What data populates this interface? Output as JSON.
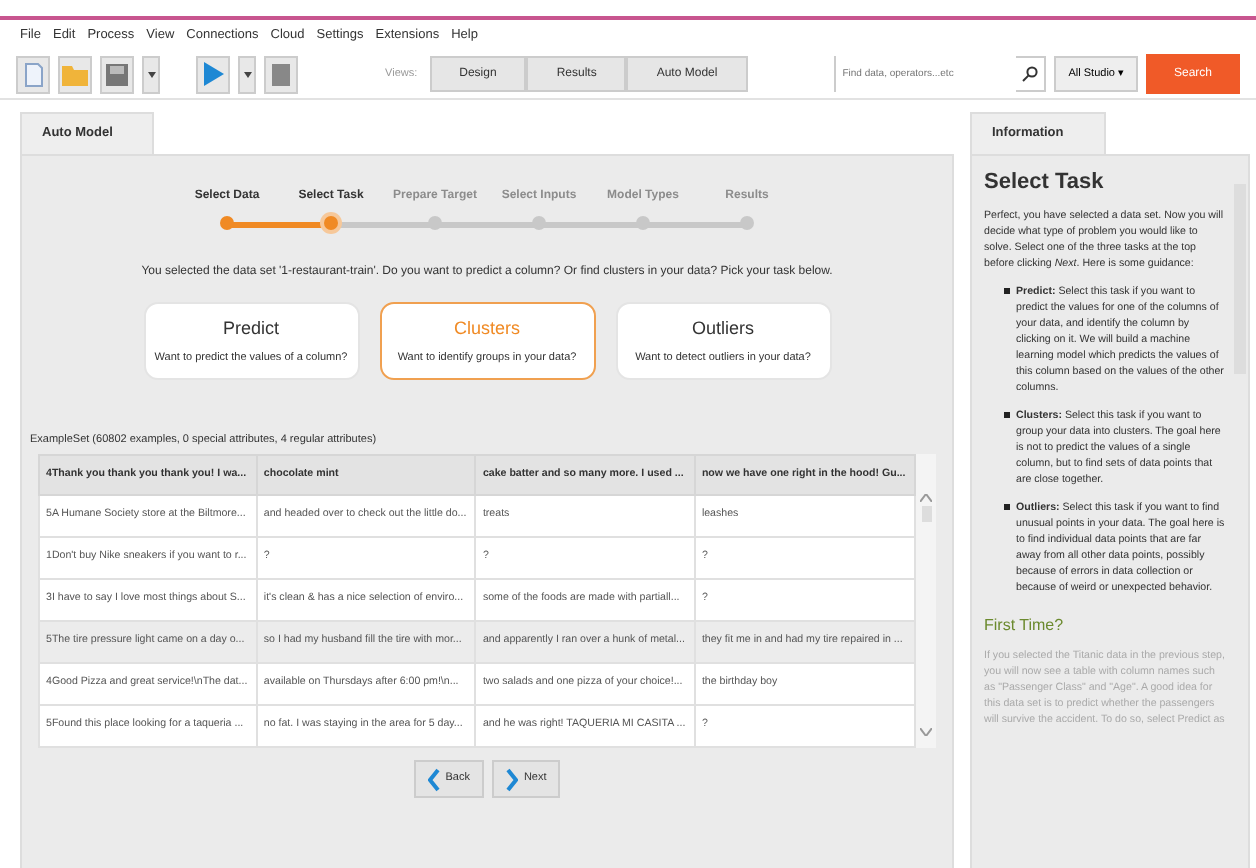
{
  "menu": [
    "File",
    "Edit",
    "Process",
    "View",
    "Connections",
    "Cloud",
    "Settings",
    "Extensions",
    "Help"
  ],
  "views": {
    "label": "Views:",
    "buttons": [
      "Design",
      "Results",
      "Auto Model"
    ]
  },
  "search": {
    "placeholder": "Find data, operators...etc",
    "scope": "All Studio ▾",
    "button": "Search"
  },
  "main_tab": "Auto Model",
  "steps": [
    {
      "label": "Select Data",
      "done": true,
      "selected": false
    },
    {
      "label": "Select Task",
      "done": true,
      "selected": true
    },
    {
      "label": "Prepare Target",
      "done": false,
      "selected": false
    },
    {
      "label": "Select Inputs",
      "done": false,
      "selected": false
    },
    {
      "label": "Model Types",
      "done": false,
      "selected": false
    },
    {
      "label": "Results",
      "done": false,
      "selected": false
    }
  ],
  "prompt": "You selected the data set '1-restaurant-train'. Do you want to predict a column?  Or find clusters in your data?  Pick your task below.",
  "tasks": [
    {
      "title": "Predict",
      "description": "Want to predict the values of a column?",
      "selected": false
    },
    {
      "title": "Clusters",
      "description": "Want to identify groups in your data?",
      "selected": true
    },
    {
      "title": "Outliers",
      "description": "Want to detect outliers in your data?",
      "selected": false
    }
  ],
  "table": {
    "caption": "ExampleSet (60802 examples, 0 special attributes, 4 regular attributes)",
    "columns": [
      "4Thank you thank you thank you! I wa...",
      "chocolate mint",
      "cake batter and so many more.  I used ...",
      "now we have one right in the hood! Gu..."
    ],
    "rows": [
      {
        "cells": [
          "5A Humane Society store at the Biltmore...",
          "and headed over to check out the little do...",
          "treats",
          "leashes"
        ],
        "selected": false
      },
      {
        "cells": [
          "1Don't buy Nike sneakers if you want to r...",
          "?",
          "?",
          "?"
        ],
        "selected": false
      },
      {
        "cells": [
          "3I have to say I love most things about S...",
          "it's clean & has a nice selection of enviro...",
          "some of the foods are made with partiall...",
          "?"
        ],
        "selected": false
      },
      {
        "cells": [
          "5The tire pressure light came on a day o...",
          "so I had my husband fill the tire with mor...",
          "and apparently I ran over a hunk of metal...",
          "they fit me in and had my tire repaired in ..."
        ],
        "selected": true
      },
      {
        "cells": [
          "4Good Pizza and great service!\\nThe dat...",
          "available on Thursdays after 6:00 pm!\\n...",
          "two salads and one pizza of your choice!...",
          "the birthday boy"
        ],
        "selected": false
      },
      {
        "cells": [
          "5Found this place looking for a taqueria ...",
          "no fat. I was staying in the area for 5 day...",
          "and he was right! TAQUERIA MI CASITA ...",
          "?"
        ],
        "selected": false
      }
    ]
  },
  "nav": {
    "back": "Back",
    "next": "Next"
  },
  "info": {
    "tab": "Information",
    "title": "Select Task",
    "intro": "Perfect, you have selected a data set. Now you will decide what type of problem you would like to solve. Select one of the three tasks at the top before clicking *Next*. Here is some guidance:",
    "bullets": [
      "**Predict:** Select this task if you want to predict the values for one of the columns of your data, and identify the column by clicking on it. We will build a machine learning model which predicts the values of this column based on the values of the other columns.",
      "**Clusters:** Select this task if you want to group your data into clusters. The goal here is not to predict the values of a single column, but to find sets of data points that are close together.",
      "**Outliers:** Select this task if you want to find unusual points in your data. The goal here is to find individual data points that are far away from all other data points, possibly because of errors in data collection or because of weird or unexpected behavior."
    ],
    "subtitle": "First Time?",
    "first_time": "If you selected the Titanic data in the previous step, you will now see a table with column names such as \"Passenger Class\" and \"Age\". A good idea for this data set is to predict whether the passengers will survive the accident. To do so, select Predict as"
  }
}
